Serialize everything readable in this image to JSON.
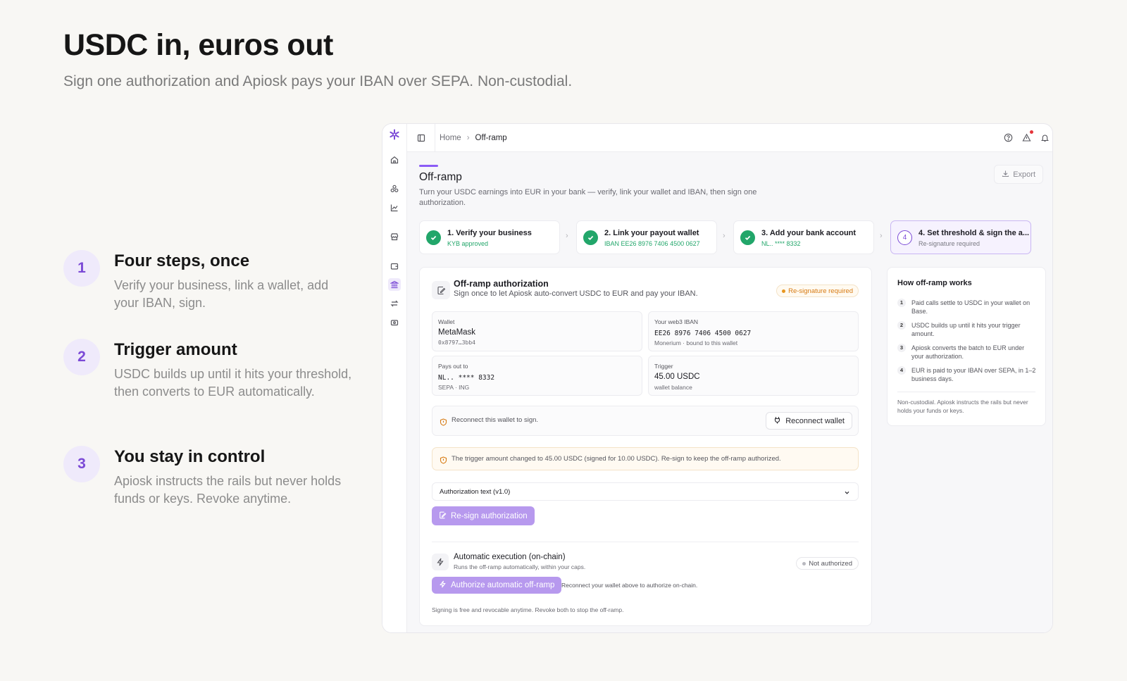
{
  "hero": {
    "title": "USDC in, euros out",
    "subtitle": "Sign one authorization and Apiosk pays your IBAN over SEPA. Non-custodial."
  },
  "features": [
    {
      "num": "1",
      "title": "Four steps, once",
      "desc": "Verify your business, link a wallet, add your IBAN, sign."
    },
    {
      "num": "2",
      "title": "Trigger amount",
      "desc": "USDC builds up until it hits your threshold, then converts to EUR automatically."
    },
    {
      "num": "3",
      "title": "You stay in control",
      "desc": "Apiosk instructs the rails but never holds funds or keys. Revoke anytime."
    }
  ],
  "breadcrumb": {
    "home": "Home",
    "current": "Off-ramp"
  },
  "page": {
    "title": "Off-ramp",
    "desc": "Turn your USDC earnings into EUR in your bank — verify, link your wallet and IBAN, then sign one authorization.",
    "export_label": "Export"
  },
  "steps": [
    {
      "title": "1. Verify your business",
      "sub": "KYB approved"
    },
    {
      "title": "2. Link your payout wallet",
      "sub": "IBAN EE26 8976 7406 4500 0627"
    },
    {
      "title": "3. Add your bank account",
      "sub": "NL.. **** 8332"
    },
    {
      "num": "4",
      "title": "4. Set threshold & sign the a...",
      "sub": "Re-signature required"
    }
  ],
  "auth": {
    "title": "Off-ramp authorization",
    "subtitle": "Sign once to let Apiosk auto-convert USDC to EUR and pay your IBAN.",
    "badge": "Re-signature required",
    "wallet": {
      "label": "Wallet",
      "value": "MetaMask",
      "sub": "0x8797…3bb4"
    },
    "iban": {
      "label": "Your web3 IBAN",
      "value": "EE26 8976 7406 4500 0627",
      "sub": "Monerium · bound to this wallet"
    },
    "payout": {
      "label": "Pays out to",
      "value": "NL.. **** 8332",
      "sub": "SEPA · ING"
    },
    "trigger": {
      "label": "Trigger",
      "value": "45.00 USDC",
      "sub": "wallet balance"
    },
    "reconnect_text": "Reconnect this wallet to sign.",
    "reconnect_button": "Reconnect wallet",
    "alert": "The trigger amount changed to 45.00 USDC (signed for 10.00 USDC). Re-sign to keep the off-ramp authorized.",
    "auth_text_label": "Authorization text (v1.0)",
    "resign_button": "Re-sign authorization"
  },
  "automatic": {
    "title": "Automatic execution (on-chain)",
    "subtitle": "Runs the off-ramp automatically, within your caps.",
    "badge": "Not authorized",
    "button": "Authorize automatic off-ramp",
    "hint": "Reconnect your wallet above to authorize on-chain.",
    "footer": "Signing is free and revocable anytime. Revoke both to stop the off-ramp."
  },
  "how": {
    "title": "How off-ramp works",
    "items": [
      {
        "n": "1",
        "text": "Paid calls settle to USDC in your wallet on Base."
      },
      {
        "n": "2",
        "text": "USDC builds up until it hits your trigger amount."
      },
      {
        "n": "3",
        "text": "Apiosk converts the batch to EUR under your authorization."
      },
      {
        "n": "4",
        "text": "EUR is paid to your IBAN over SEPA, in 1–2 business days."
      }
    ],
    "note": "Non-custodial. Apiosk instructs the rails but never holds your funds or keys."
  },
  "colors": {
    "accent": "#8b5cf6",
    "success": "#22a66a",
    "warning": "#e8961f",
    "primary_button": "#b799ee"
  }
}
